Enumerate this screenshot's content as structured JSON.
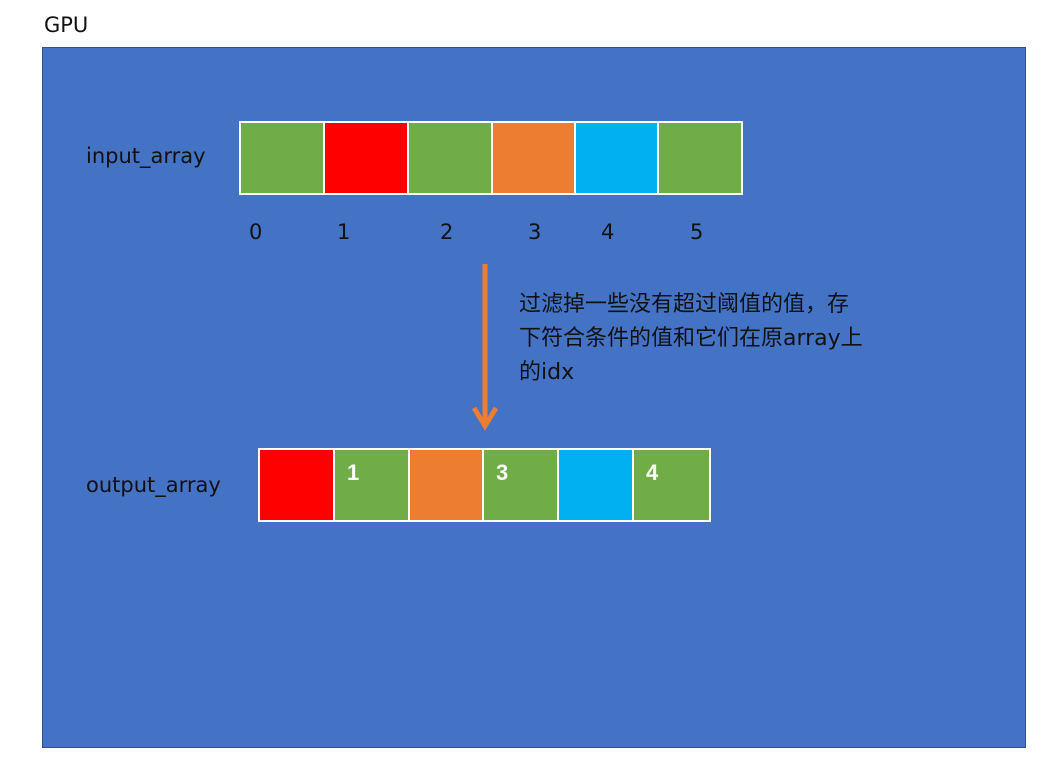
{
  "gpu_label": "GPU",
  "input_label": "input_array",
  "output_label": "output_array",
  "input_cells": [
    {
      "color": "#70AD47"
    },
    {
      "color": "#FF0000"
    },
    {
      "color": "#70AD47"
    },
    {
      "color": "#ED7D31"
    },
    {
      "color": "#00B0F0"
    },
    {
      "color": "#70AD47"
    }
  ],
  "input_indices": [
    "0",
    "1",
    "2",
    "3",
    "4",
    "5"
  ],
  "output_cells": [
    {
      "color": "#FF0000",
      "text": ""
    },
    {
      "color": "#70AD47",
      "text": "1"
    },
    {
      "color": "#ED7D31",
      "text": ""
    },
    {
      "color": "#70AD47",
      "text": "3"
    },
    {
      "color": "#00B0F0",
      "text": ""
    },
    {
      "color": "#70AD47",
      "text": "4"
    }
  ],
  "arrow_color": "#ED7D31",
  "note_lines": [
    "过滤掉一些没有超过阈值的值，存",
    "下符合条件的值和它们在原array上",
    "的idx"
  ]
}
